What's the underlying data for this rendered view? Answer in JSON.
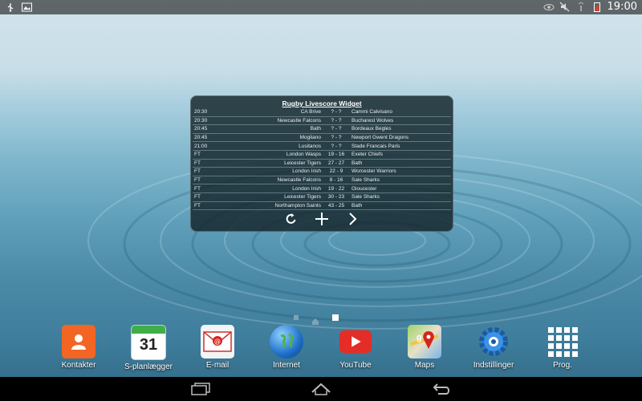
{
  "status_bar": {
    "time": "19:00",
    "left_icons": [
      "usb-icon",
      "image-icon"
    ],
    "right_icons": [
      "eye-icon",
      "mute-icon",
      "wifi-icon",
      "battery-icon"
    ]
  },
  "widget": {
    "title": "Rugby Livescore Widget",
    "matches": [
      {
        "time": "20:30",
        "home": "CA Brive",
        "score": "? - ?",
        "away": "Cammi Calvisano"
      },
      {
        "time": "20:30",
        "home": "Newcastle Falcons",
        "score": "? - ?",
        "away": "Bucharest Wolves"
      },
      {
        "time": "20:45",
        "home": "Bath",
        "score": "? - ?",
        "away": "Bordeaux Begles"
      },
      {
        "time": "20:45",
        "home": "Mogliano",
        "score": "? - ?",
        "away": "Newport Gwent Dragons"
      },
      {
        "time": "21:00",
        "home": "Lusitanos",
        "score": "? - ?",
        "away": "Stade Francais Paris"
      },
      {
        "time": "FT",
        "home": "London Wasps",
        "score": "19 - 16",
        "away": "Exeter Chiefs"
      },
      {
        "time": "FT",
        "home": "Leicester Tigers",
        "score": "27 - 27",
        "away": "Bath"
      },
      {
        "time": "FT",
        "home": "London Irish",
        "score": "22 - 9",
        "away": "Worcester Warriors"
      },
      {
        "time": "FT",
        "home": "Newcastle Falcons",
        "score": "8 - 16",
        "away": "Sale Sharks"
      },
      {
        "time": "FT",
        "home": "London Irish",
        "score": "19 - 22",
        "away": "Gloucester"
      },
      {
        "time": "FT",
        "home": "Leicester Tigers",
        "score": "30 - 23",
        "away": "Sale Sharks"
      },
      {
        "time": "FT",
        "home": "Northampton Saints",
        "score": "43 - 25",
        "away": "Bath"
      }
    ],
    "controls": [
      "refresh-icon",
      "plus-icon",
      "chevron-right-icon"
    ]
  },
  "dock": {
    "apps": [
      {
        "label": "Kontakter",
        "icon": "contacts-icon",
        "color": "#f26522"
      },
      {
        "label": "S-planlægger",
        "icon": "calendar-icon",
        "day": "31",
        "color": "#ffffff"
      },
      {
        "label": "E-mail",
        "icon": "email-icon",
        "color": "#ffffff"
      },
      {
        "label": "Internet",
        "icon": "globe-icon",
        "color": "#1e6fc8"
      },
      {
        "label": "YouTube",
        "icon": "youtube-icon",
        "color": "#e52d27"
      },
      {
        "label": "Maps",
        "icon": "maps-icon",
        "color": "#6ab04c"
      },
      {
        "label": "Indstillinger",
        "icon": "settings-icon",
        "color": "#2a7fd4"
      },
      {
        "label": "Prog.",
        "icon": "apps-grid-icon",
        "color": "#ffffff"
      }
    ]
  },
  "navbar": {
    "buttons": [
      "recent-apps-icon",
      "home-icon",
      "back-icon"
    ]
  }
}
